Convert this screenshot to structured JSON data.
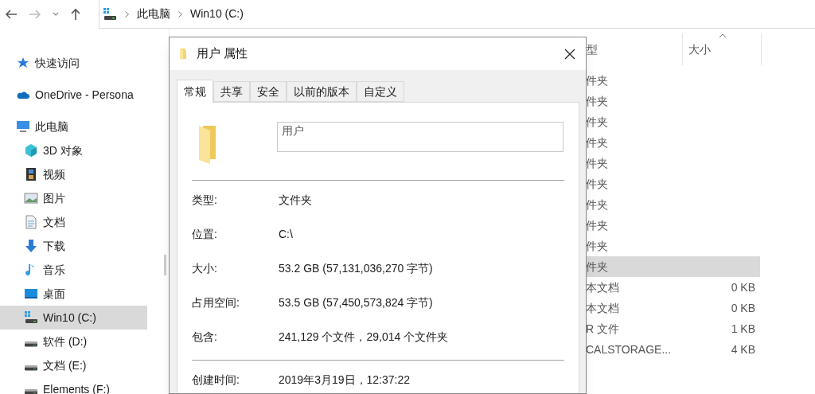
{
  "address_bar": {
    "path": [
      "此电脑",
      "Win10 (C:)"
    ]
  },
  "nav_pane": {
    "items": [
      {
        "label": "快速访问",
        "kind": "star",
        "selected": false
      },
      {
        "label": "OneDrive - Persona",
        "kind": "cloud",
        "selected": false
      },
      {
        "label": "此电脑",
        "kind": "pc",
        "selected": false,
        "children": [
          {
            "label": "3D 对象",
            "kind": "cube",
            "selected": false
          },
          {
            "label": "视频",
            "kind": "video",
            "selected": false
          },
          {
            "label": "图片",
            "kind": "image",
            "selected": false
          },
          {
            "label": "文档",
            "kind": "doc",
            "selected": false
          },
          {
            "label": "下载",
            "kind": "download",
            "selected": false
          },
          {
            "label": "音乐",
            "kind": "music",
            "selected": false
          },
          {
            "label": "桌面",
            "kind": "desktop",
            "selected": false
          },
          {
            "label": "Win10 (C:)",
            "kind": "sysdrive",
            "selected": true
          },
          {
            "label": "软件 (D:)",
            "kind": "drive",
            "selected": false
          },
          {
            "label": "文档 (E:)",
            "kind": "drive",
            "selected": false
          },
          {
            "label": "Elements (F:)",
            "kind": "drive",
            "selected": false
          }
        ]
      }
    ]
  },
  "file_list": {
    "columns": [
      {
        "label": "型",
        "sorted": false
      },
      {
        "label": "大小",
        "sorted": true
      }
    ],
    "rows": [
      {
        "type": "件夹",
        "selected": false
      },
      {
        "type": "件夹",
        "selected": false
      },
      {
        "type": "件夹",
        "selected": false
      },
      {
        "type": "件夹",
        "selected": false
      },
      {
        "type": "件夹",
        "selected": false
      },
      {
        "type": "件夹",
        "selected": false
      },
      {
        "type": "件夹",
        "selected": false
      },
      {
        "type": "件夹",
        "selected": false
      },
      {
        "type": "件夹",
        "selected": false
      },
      {
        "type": "件夹",
        "selected": true
      },
      {
        "type": "本文档",
        "size": "0 KB",
        "selected": false
      },
      {
        "type": "本文档",
        "size": "0 KB",
        "selected": false
      },
      {
        "type": "R 文件",
        "size": "1 KB",
        "selected": false
      },
      {
        "type": "CALSTORAGE...",
        "size": "4 KB",
        "selected": false
      }
    ]
  },
  "dialog": {
    "title": "用户 属性",
    "tabs": [
      {
        "label": "常规",
        "selected": true
      },
      {
        "label": "共享",
        "selected": false
      },
      {
        "label": "安全",
        "selected": false
      },
      {
        "label": "以前的版本",
        "selected": false
      },
      {
        "label": "自定义",
        "selected": false
      }
    ],
    "name_value": "用户",
    "property_groups": [
      [
        {
          "label": "类型:",
          "value": "文件夹"
        },
        {
          "label": "位置:",
          "value": "C:\\"
        },
        {
          "label": "大小:",
          "value": "53.2 GB (57,131,036,270 字节)"
        },
        {
          "label": "占用空间:",
          "value": "53.5 GB (57,450,573,824 字节)"
        },
        {
          "label": "包含:",
          "value": "241,129 个文件，29,014 个文件夹"
        }
      ],
      [
        {
          "label": "创建时间:",
          "value": "2019年3月19日，12:37:22"
        }
      ]
    ]
  }
}
